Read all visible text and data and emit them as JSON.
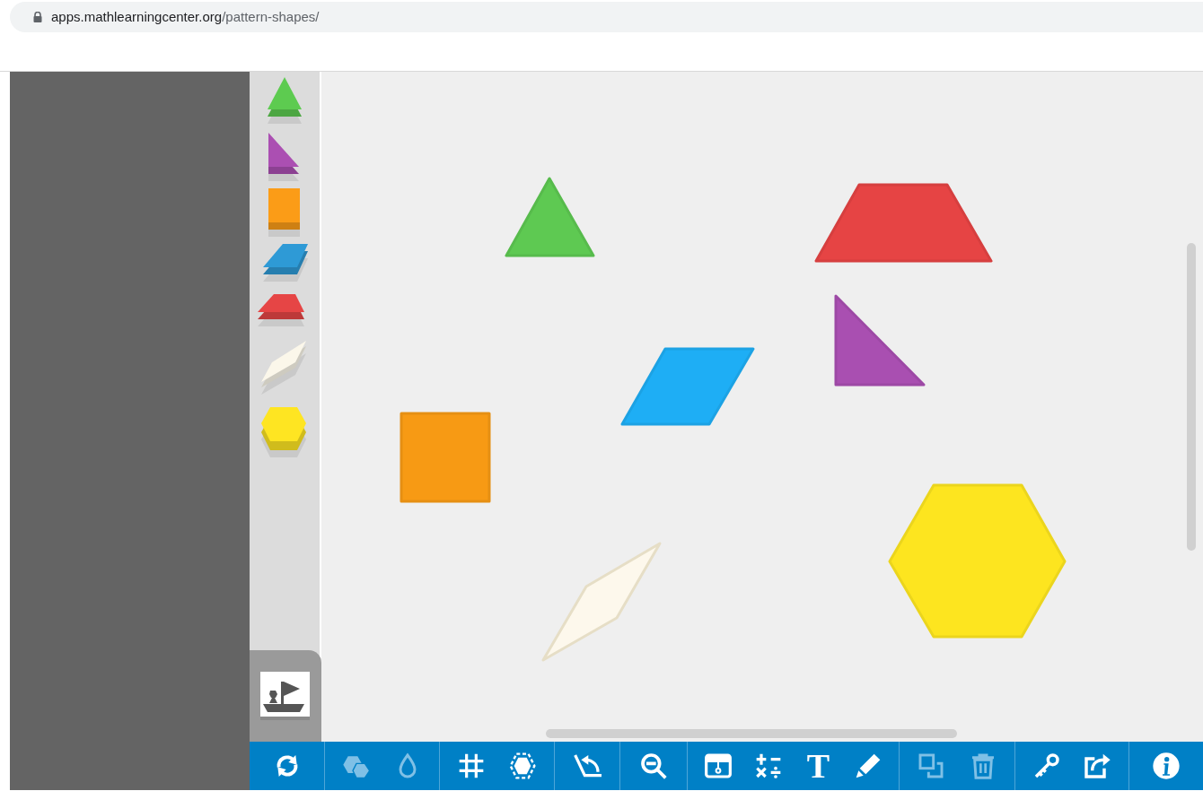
{
  "address_bar": {
    "host": "apps.mathlearningcenter.org",
    "path": "/pattern-shapes/"
  },
  "palette": [
    {
      "kind": "triangle",
      "color": "#5dcb50"
    },
    {
      "kind": "right-triangle",
      "color": "#ab4fb2"
    },
    {
      "kind": "square",
      "color": "#fb9c17"
    },
    {
      "kind": "rhombus",
      "color": "#2e9ad6"
    },
    {
      "kind": "trapezoid",
      "color": "#e64545"
    },
    {
      "kind": "thin-rhombus",
      "color": "#fbf7ea"
    },
    {
      "kind": "hexagon",
      "color": "#fee522"
    }
  ],
  "canvas_shapes": [
    {
      "kind": "triangle",
      "color": "#5ec952"
    },
    {
      "kind": "trapezoid",
      "color": "#e64444"
    },
    {
      "kind": "right-triangle",
      "color": "#a94fb1"
    },
    {
      "kind": "rhombus",
      "color": "#1eaef5"
    },
    {
      "kind": "square",
      "color": "#f79a14"
    },
    {
      "kind": "thin-rhombus",
      "color": "#fdf8ec"
    },
    {
      "kind": "hexagon",
      "color": "#fde51f"
    }
  ],
  "toolbar": [
    {
      "items": [
        {
          "kind": "rotate",
          "disabled": false
        }
      ]
    },
    {
      "items": [
        {
          "kind": "hexagons",
          "disabled": true
        },
        {
          "kind": "droplet",
          "disabled": true
        }
      ]
    },
    {
      "items": [
        {
          "kind": "grid",
          "disabled": false
        },
        {
          "kind": "dashed-hexagon",
          "disabled": false
        }
      ]
    },
    {
      "items": [
        {
          "kind": "angle",
          "disabled": false
        }
      ]
    },
    {
      "items": [
        {
          "kind": "zoom-out",
          "disabled": false
        }
      ]
    },
    {
      "items": [
        {
          "kind": "panel",
          "disabled": false
        },
        {
          "kind": "operations",
          "disabled": false
        },
        {
          "kind": "text",
          "glyph": "T",
          "disabled": false
        },
        {
          "kind": "pencil",
          "disabled": false
        }
      ]
    },
    {
      "items": [
        {
          "kind": "duplicate",
          "disabled": true
        },
        {
          "kind": "trash",
          "disabled": true
        }
      ]
    },
    {
      "items": [
        {
          "kind": "key",
          "disabled": false
        },
        {
          "kind": "share",
          "disabled": false
        }
      ]
    },
    {
      "items": [
        {
          "kind": "info",
          "disabled": false
        }
      ]
    }
  ]
}
